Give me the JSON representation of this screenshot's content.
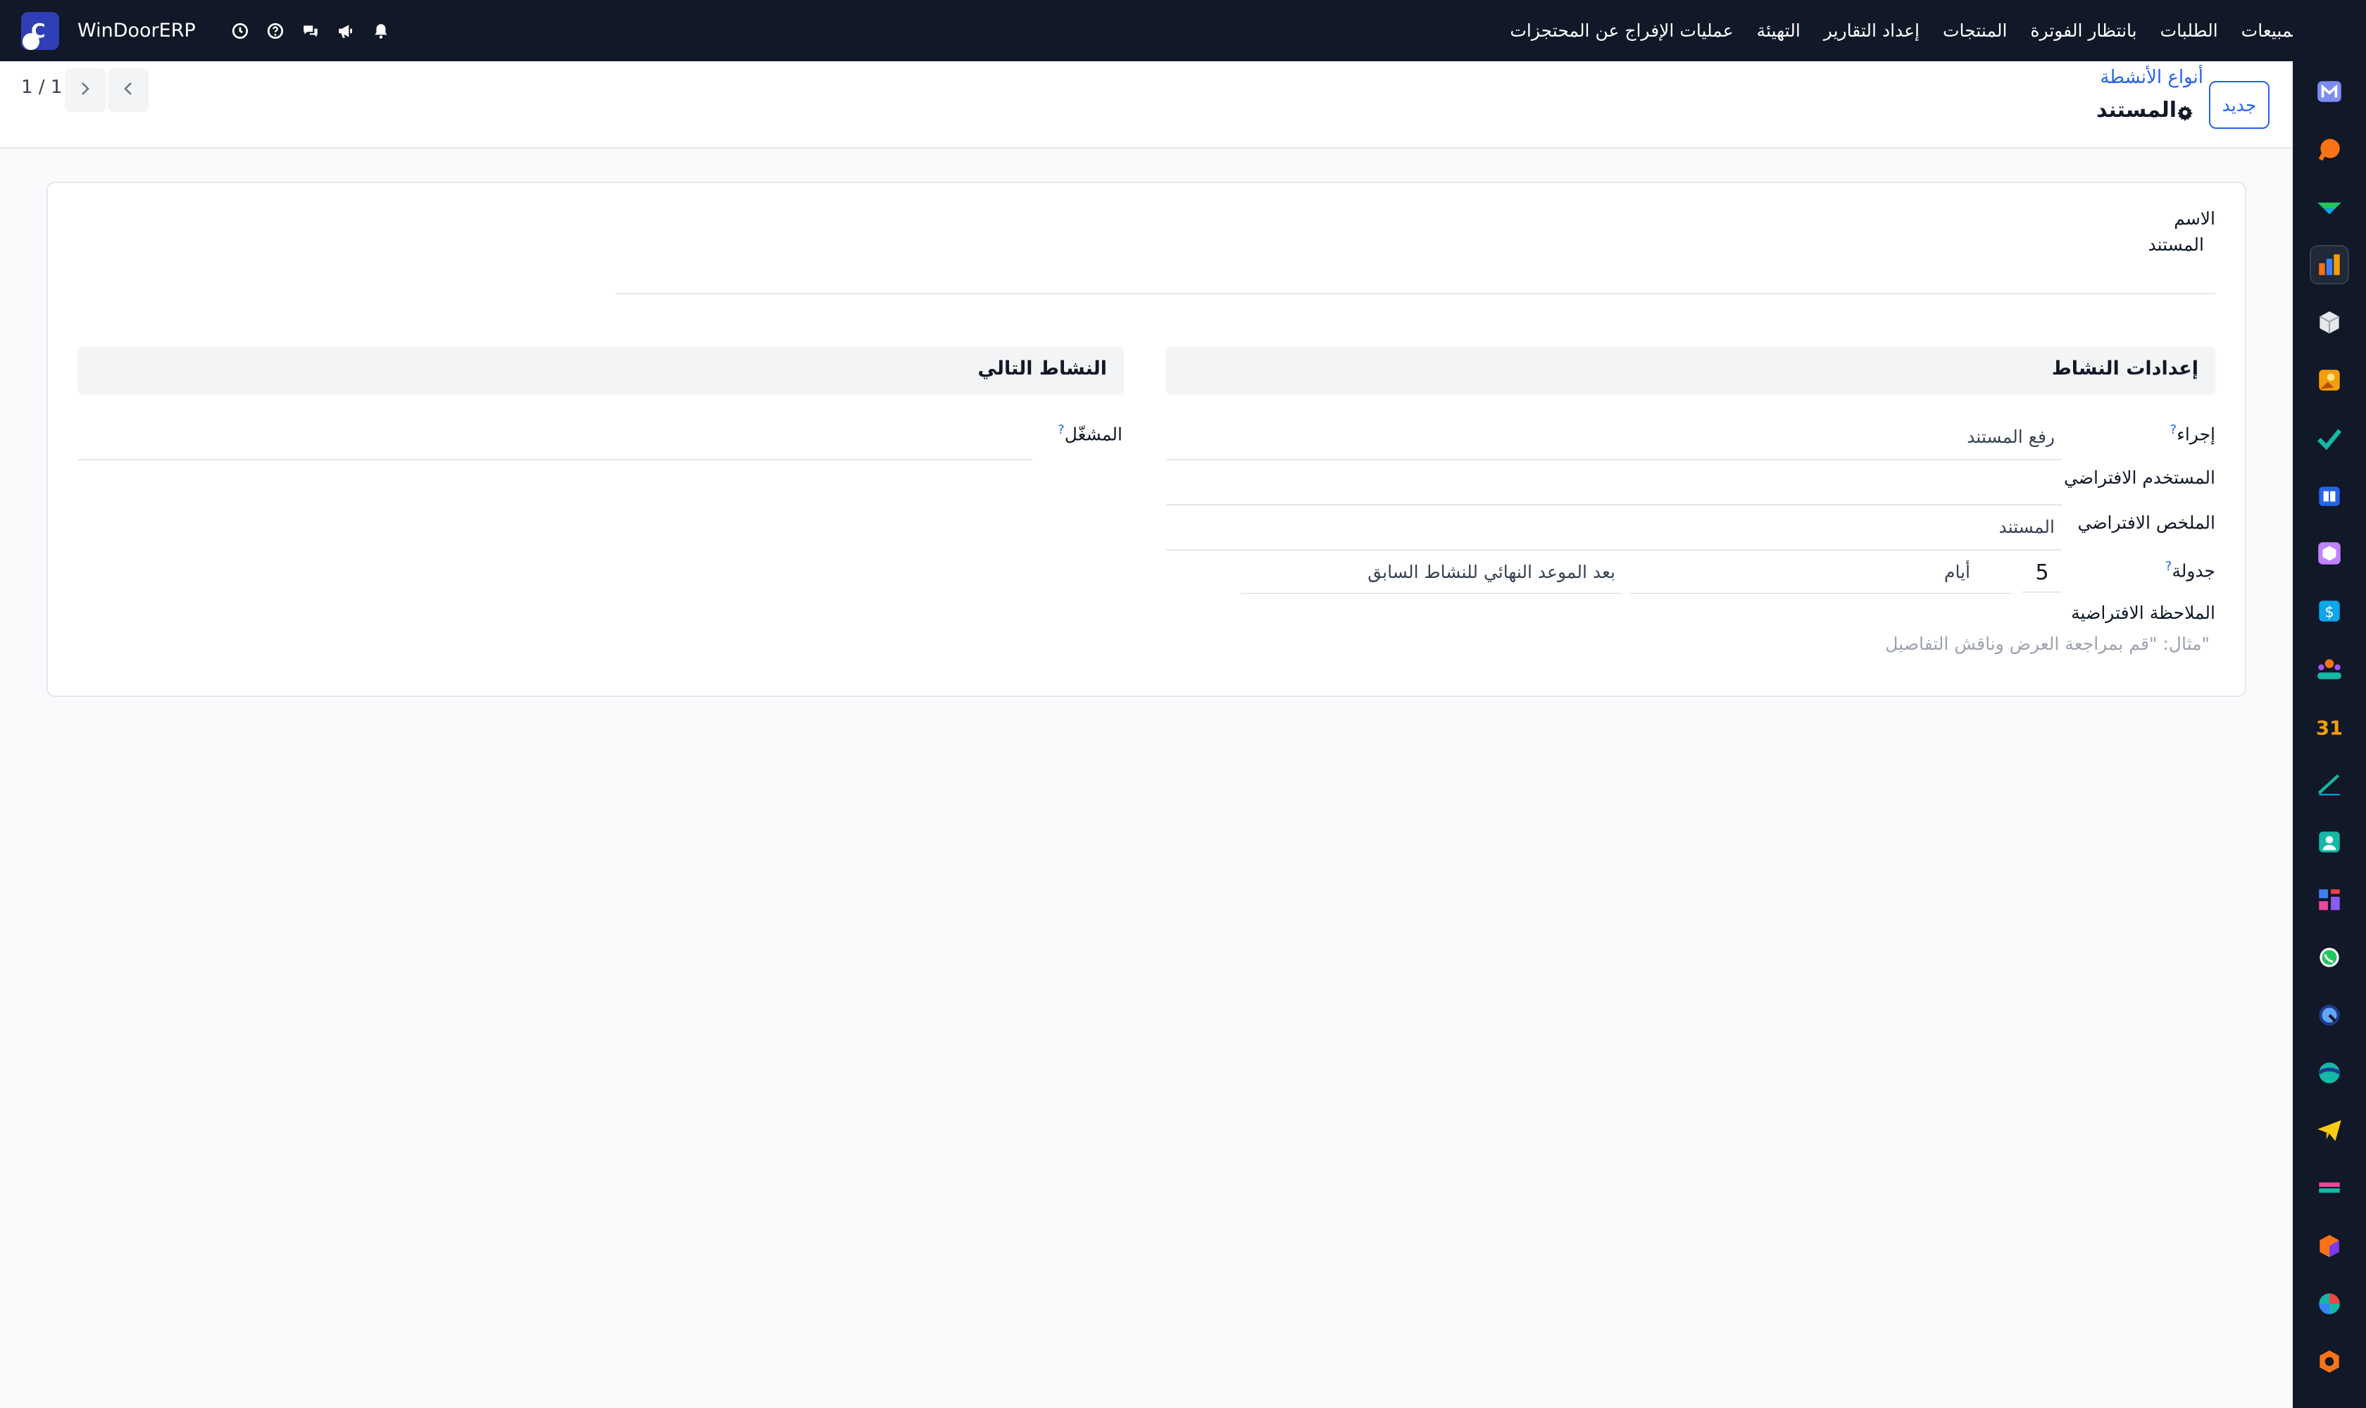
{
  "navbar": {
    "menu": [
      "المبيعات",
      "الطلبات",
      "بانتظار الفوترة",
      "المنتجات",
      "إعداد التقارير",
      "التهيئة",
      "عمليات الإفراج عن المحتجزات"
    ],
    "brand": "WinDoorERP",
    "logo_letter": "C",
    "icons": [
      "clock-icon",
      "help-icon",
      "chat-icon",
      "megaphone-icon",
      "bell-icon"
    ]
  },
  "control_panel": {
    "new_button": "جديد",
    "breadcrumb": "أنواع الأنشطة",
    "record_title": "المستند",
    "pager": "1 / 1"
  },
  "form": {
    "name_label": "الاسم",
    "name_value": "المستند",
    "activity_settings": {
      "title": "إعدادات النشاط",
      "action_label": "إجراء",
      "action_value": "رفع المستند",
      "default_user_label": "المستخدم الافتراضي",
      "default_user_value": "",
      "default_summary_label": "الملخص الافتراضي",
      "default_summary_value": "المستند",
      "schedule_label": "جدولة",
      "schedule_number": "5",
      "schedule_unit": "أيام",
      "schedule_after": "بعد الموعد النهائي للنشاط السابق",
      "default_note_label": "الملاحظة الافتراضية",
      "default_note_placeholder": "مثال: \"قم بمراجعة العرض وناقش التفاصيل\""
    },
    "next_activity": {
      "title": "النشاط التالي",
      "trigger_label": "المشغّل",
      "trigger_value": ""
    },
    "help_mark": "?"
  },
  "sidebar_apps": [
    "gmail-icon",
    "chat-bubble-icon",
    "inventory-icon",
    "reporting-icon",
    "box-icon",
    "photo-icon",
    "todo-icon",
    "knowledge-icon",
    "package-icon",
    "billing-icon",
    "team-icon",
    "calendar-icon",
    "sign-icon",
    "contacts-icon",
    "dashboard-icon",
    "whatsapp-icon",
    "discuss-icon",
    "website-icon",
    "telegram-icon",
    "bank-icon",
    "hexagon-icon",
    "pie-icon",
    "hexagon-outline-icon"
  ],
  "colors": {
    "navbar_bg": "#111827",
    "accent": "#2563eb",
    "sheet_bg": "#ffffff",
    "page_bg": "#f9fafb"
  }
}
